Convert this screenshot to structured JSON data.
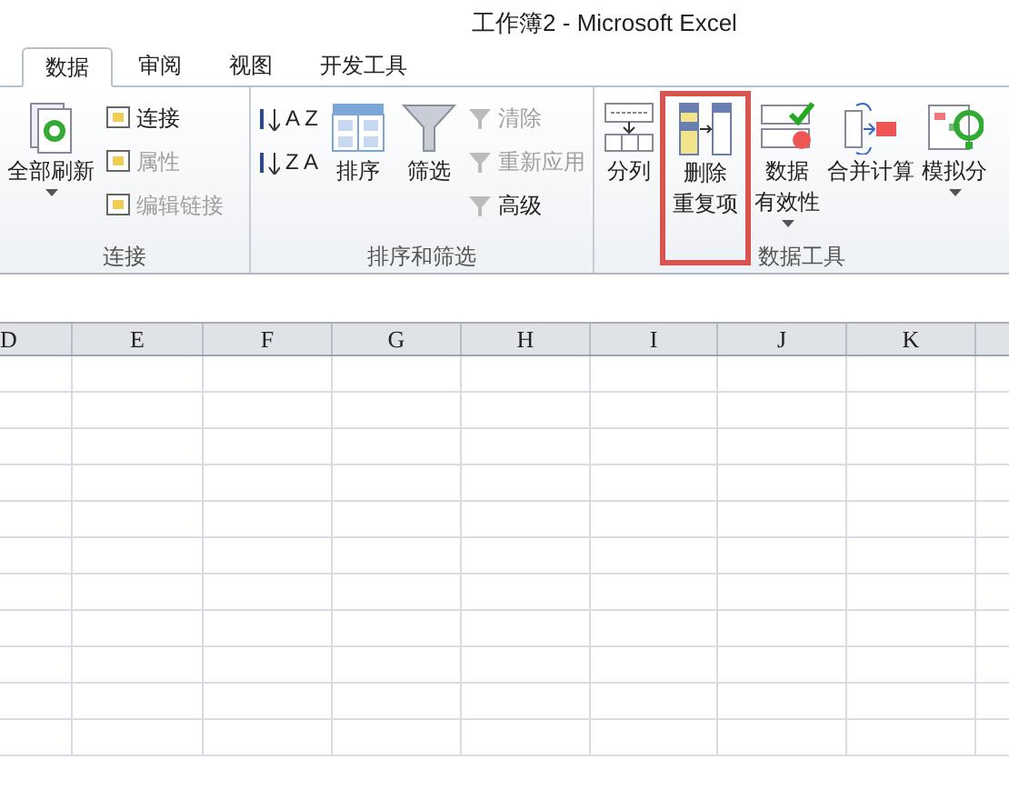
{
  "window": {
    "title": "工作簿2  -  Microsoft Excel"
  },
  "tabs": [
    {
      "label": "数据",
      "selected": true
    },
    {
      "label": "审阅",
      "selected": false
    },
    {
      "label": "视图",
      "selected": false
    },
    {
      "label": "开发工具",
      "selected": false
    }
  ],
  "ribbon_groups": [
    {
      "label": "连接",
      "items": [
        {
          "kind": "large",
          "label_lines": [
            "全部刷新"
          ],
          "dropdown": true,
          "highlighted": false
        },
        {
          "kind": "stack",
          "items": [
            {
              "label": "连接",
              "disabled": false
            },
            {
              "label": "属性",
              "disabled": true
            },
            {
              "label": "编辑链接",
              "disabled": true
            }
          ]
        }
      ]
    },
    {
      "label": "排序和筛选",
      "items": [
        {
          "kind": "stack",
          "items": [
            {
              "label": "A Z",
              "disabled": false
            },
            {
              "label": "Z A",
              "disabled": false
            }
          ]
        },
        {
          "kind": "large",
          "label_lines": [
            "排序"
          ],
          "dropdown": false,
          "highlighted": false
        },
        {
          "kind": "large",
          "label_lines": [
            "筛选"
          ],
          "dropdown": false,
          "highlighted": false
        },
        {
          "kind": "stack",
          "items": [
            {
              "label": "清除",
              "disabled": true
            },
            {
              "label": "重新应用",
              "disabled": true
            },
            {
              "label": "高级",
              "disabled": false
            }
          ]
        }
      ]
    },
    {
      "label": "数据工具",
      "items": [
        {
          "kind": "large",
          "label_lines": [
            "分列"
          ],
          "dropdown": false,
          "highlighted": false
        },
        {
          "kind": "large",
          "label_lines": [
            "删除",
            "重复项"
          ],
          "dropdown": false,
          "highlighted": true
        },
        {
          "kind": "large",
          "label_lines": [
            "数据",
            "有效性"
          ],
          "dropdown": true,
          "highlighted": false
        },
        {
          "kind": "large",
          "label_lines": [
            "合并计算"
          ],
          "dropdown": false,
          "highlighted": false
        },
        {
          "kind": "large",
          "label_lines": [
            "模拟分"
          ],
          "dropdown": true,
          "highlighted": false
        }
      ]
    }
  ],
  "sheet": {
    "columns": [
      "D",
      "E",
      "F",
      "G",
      "H",
      "I",
      "J",
      "K"
    ]
  }
}
